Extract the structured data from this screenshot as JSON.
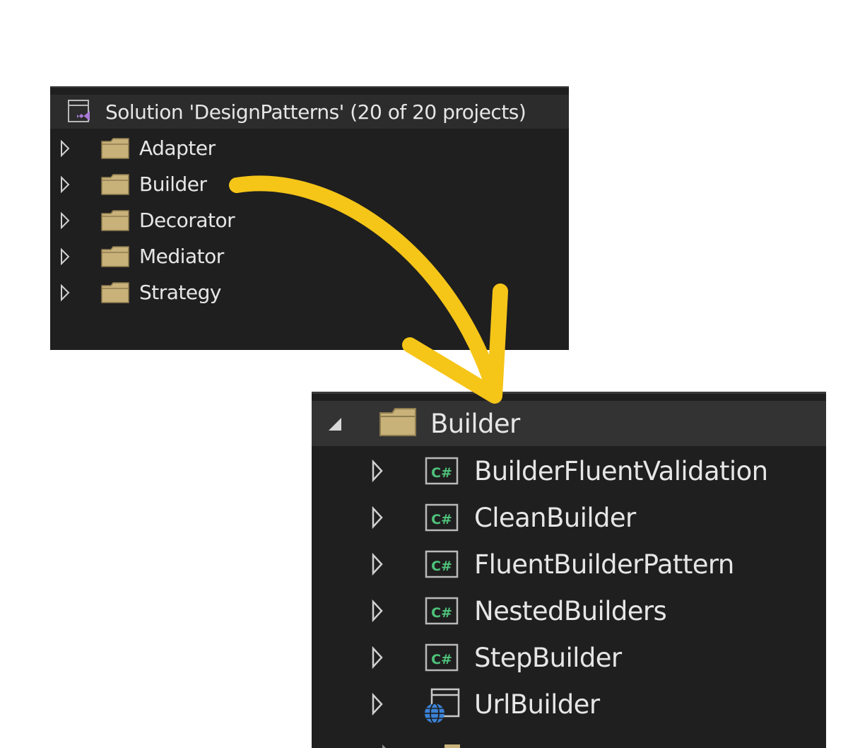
{
  "top_panel": {
    "solution_label": "Solution 'DesignPatterns' (20 of 20 projects)",
    "folders": [
      "Adapter",
      "Builder",
      "Decorator",
      "Mediator",
      "Strategy"
    ]
  },
  "bottom_panel": {
    "folder_label": "Builder",
    "projects": [
      {
        "label": "BuilderFluentValidation",
        "icon": "csharp-project-icon"
      },
      {
        "label": "CleanBuilder",
        "icon": "csharp-project-icon"
      },
      {
        "label": "FluentBuilderPattern",
        "icon": "csharp-project-icon"
      },
      {
        "label": "NestedBuilders",
        "icon": "csharp-project-icon"
      },
      {
        "label": "StepBuilder",
        "icon": "csharp-project-icon"
      },
      {
        "label": "UrlBuilder",
        "icon": "web-project-icon"
      }
    ]
  },
  "colors": {
    "panel_bg": "#1f1f1f",
    "arrow": "#f5c518",
    "folder": "#c8b27a",
    "text": "#e6e6e6"
  }
}
